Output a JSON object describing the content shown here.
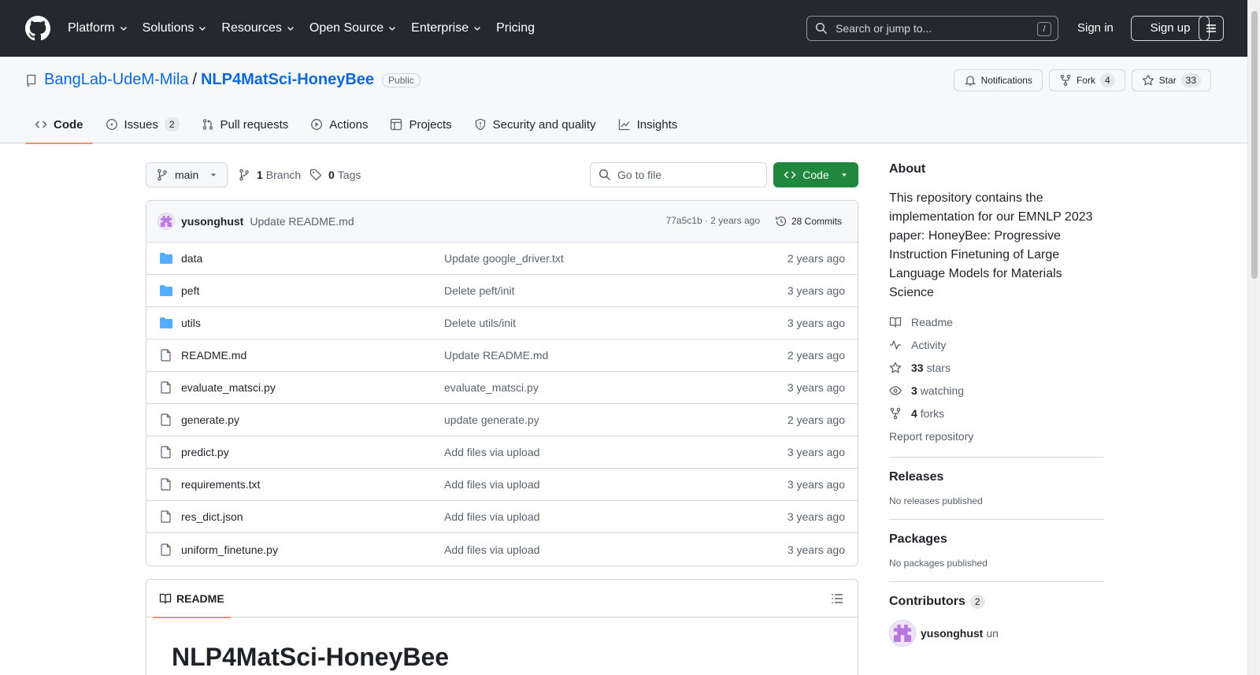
{
  "header": {
    "nav": [
      "Platform",
      "Solutions",
      "Resources",
      "Open Source",
      "Enterprise",
      "Pricing"
    ],
    "search_placeholder": "Search or jump to...",
    "search_key": "/",
    "sign_in": "Sign in",
    "sign_up": "Sign up"
  },
  "repo": {
    "owner": "BangLab-UdeM-Mila",
    "separator": "/",
    "name": "NLP4MatSci-HoneyBee",
    "visibility": "Public",
    "notifications_label": "Notifications",
    "fork_label": "Fork",
    "fork_count": "4",
    "star_label": "Star",
    "star_count": "33"
  },
  "tabs": [
    {
      "label": "Code"
    },
    {
      "label": "Issues",
      "count": "2"
    },
    {
      "label": "Pull requests"
    },
    {
      "label": "Actions"
    },
    {
      "label": "Projects"
    },
    {
      "label": "Security and quality"
    },
    {
      "label": "Insights"
    }
  ],
  "toolbar": {
    "branch": "main",
    "branch_count": "1",
    "branch_label": "Branch",
    "tag_count": "0",
    "tag_label": "Tags",
    "goto_placeholder": "Go to file",
    "code_label": "Code"
  },
  "commit": {
    "author": "yusonghust",
    "message": "Update README.md",
    "meta": "77a5c1b · 2 years ago",
    "commits": "28 Commits"
  },
  "files": [
    {
      "name": "data",
      "type": "folder",
      "commit": "Update google_driver.txt",
      "age": "2 years ago"
    },
    {
      "name": "peft",
      "type": "folder",
      "commit": "Delete peft/init",
      "age": "3 years ago"
    },
    {
      "name": "utils",
      "type": "folder",
      "commit": "Delete utils/init",
      "age": "3 years ago"
    },
    {
      "name": "README.md",
      "type": "file",
      "commit": "Update README.md",
      "age": "2 years ago"
    },
    {
      "name": "evaluate_matsci.py",
      "type": "file",
      "commit": "evaluate_matsci.py",
      "age": "3 years ago"
    },
    {
      "name": "generate.py",
      "type": "file",
      "commit": "update generate.py",
      "age": "2 years ago"
    },
    {
      "name": "predict.py",
      "type": "file",
      "commit": "Add files via upload",
      "age": "3 years ago"
    },
    {
      "name": "requirements.txt",
      "type": "file",
      "commit": "Add files via upload",
      "age": "3 years ago"
    },
    {
      "name": "res_dict.json",
      "type": "file",
      "commit": "Add files via upload",
      "age": "3 years ago"
    },
    {
      "name": "uniform_finetune.py",
      "type": "file",
      "commit": "Add files via upload",
      "age": "3 years ago"
    }
  ],
  "readme": {
    "tab_label": "README",
    "heading": "NLP4MatSci-HoneyBee"
  },
  "sidebar": {
    "about_title": "About",
    "about_desc": "This repository contains the implementation for our EMNLP 2023 paper: HoneyBee: Progressive Instruction Finetuning of Large Language Models for Materials Science",
    "readme": "Readme",
    "activity": "Activity",
    "stars_count": "33",
    "stars_label": "stars",
    "watching_count": "3",
    "watching_label": "watching",
    "forks_count": "4",
    "forks_label": "forks",
    "report": "Report repository",
    "releases_title": "Releases",
    "releases_text": "No releases published",
    "packages_title": "Packages",
    "packages_text": "No packages published",
    "contributors_title": "Contributors",
    "contributors_count": "2",
    "contributor_name": "yusonghust",
    "contributor_extra": "un"
  },
  "colors": {
    "header_bg": "#24292f",
    "link": "#0969da",
    "primary_button": "#1f883d",
    "tab_underline": "#fd8c73",
    "folder": "#54aeff"
  }
}
